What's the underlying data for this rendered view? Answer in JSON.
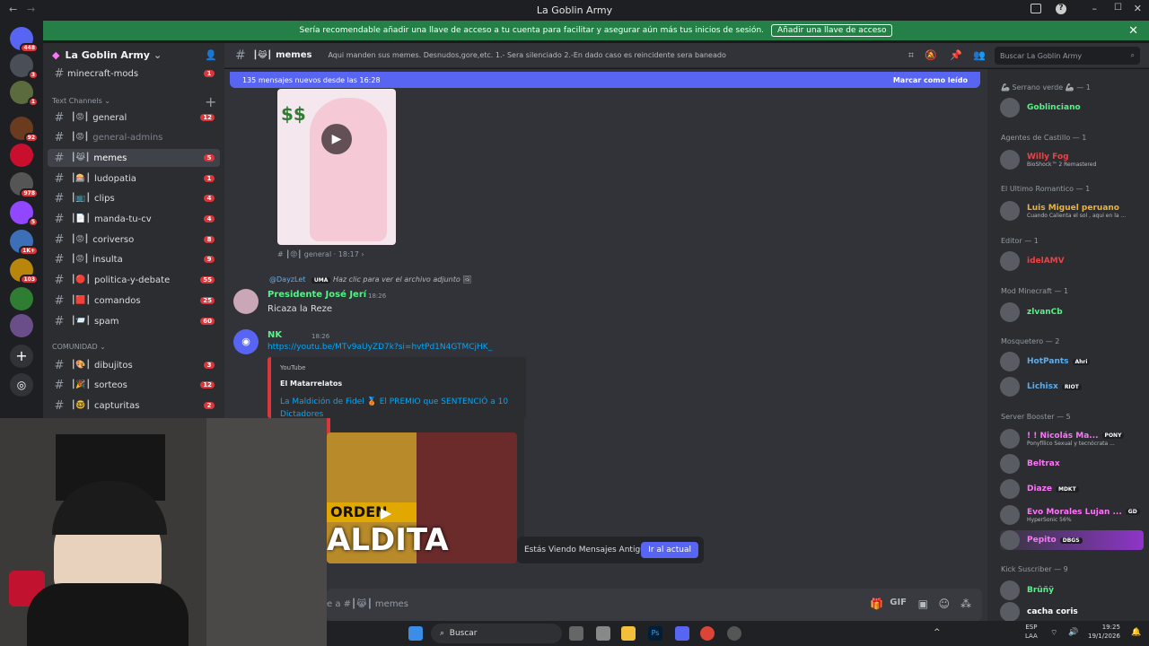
{
  "window": {
    "title": "La Goblin Army"
  },
  "banner": {
    "text": "Sería recomendable añadir una llave de acceso a tu cuenta para facilitar y asegurar aún más tus inicios de sesión.",
    "button": "Añadir una llave de acceso",
    "close": "✕"
  },
  "guilds": {
    "badges": [
      "448",
      "3",
      "1",
      "92",
      "978",
      "5",
      "1K+",
      "103"
    ]
  },
  "server": {
    "name": "La Goblin Army"
  },
  "channels": {
    "top": {
      "name": "minecraft-mods",
      "count": "1"
    },
    "text_category": "Text Channels",
    "items": [
      {
        "name": "general",
        "count": "12",
        "pre": "┃😡┃"
      },
      {
        "name": "general-admins",
        "count": "",
        "pre": "┃😡┃"
      },
      {
        "name": "memes",
        "count": "5",
        "pre": "┃😹┃"
      },
      {
        "name": "ludopatia",
        "count": "1",
        "pre": "┃🎰┃"
      },
      {
        "name": "clips",
        "count": "4",
        "pre": "┃📺┃"
      },
      {
        "name": "manda-tu-cv",
        "count": "4",
        "pre": "┃📄┃"
      },
      {
        "name": "coriverso",
        "count": "8",
        "pre": "┃😡┃"
      },
      {
        "name": "insulta",
        "count": "9",
        "pre": "┃😡┃"
      },
      {
        "name": "politica-y-debate",
        "count": "55",
        "pre": "┃🔴┃"
      },
      {
        "name": "comandos",
        "count": "25",
        "pre": "┃🟥┃"
      },
      {
        "name": "spam",
        "count": "60",
        "pre": "┃📨┃"
      }
    ],
    "community_category": "COMUNIDAD",
    "community": [
      {
        "name": "dibujitos",
        "count": "3",
        "pre": "┃🎨┃"
      },
      {
        "name": "sorteos",
        "count": "12",
        "pre": "┃🎉┃"
      },
      {
        "name": "capturitas",
        "count": "2",
        "pre": "┃🤓┃"
      }
    ]
  },
  "header": {
    "channel": "memes",
    "pre": "┃😹┃",
    "topic": "Aqui manden sus memes. Desnudos,gore,etc. 1.- Sera silenciado 2.-En dado caso es reincidente sera baneado",
    "search_placeholder": "Buscar La Goblin Army"
  },
  "newbar": {
    "text": "135 mensajes nuevos desde las 16:28",
    "mark": "Marcar como leído"
  },
  "messages": {
    "thread_ref": "general · 18:17",
    "reply_user": "@DayzLet",
    "reply_tag": "UMA",
    "reply_text": "Haz clic para ver el archivo adjunto",
    "m1": {
      "author": "Presidente José Jerí",
      "time": "18:26",
      "text": "Ricaza la Reze"
    },
    "m2": {
      "author": "NK",
      "time": "18:26",
      "link": "https://youtu.be/MTv9aUyZD7k?si=hvtPd1N4GTMCjHK_",
      "embed_provider": "YouTube",
      "embed_author": "El Matarrelatos",
      "embed_title": "La Maldición de Fidel 🥉 El PREMIO que SENTENCIÓ a 10 Dictadores"
    }
  },
  "thumb": {
    "line1": "ORDEN",
    "line2": "ALDITA"
  },
  "old_msgs": {
    "text": "Estás Viendo Mensajes Antiguos",
    "button": "Ir al actual"
  },
  "composer": {
    "placeholder": "e a #┃😹┃ memes"
  },
  "members": [
    {
      "cat": "🦾 Serrano verde 🦾 — 1",
      "name": "Goblinciano",
      "color": "#57f287"
    },
    {
      "cat": "Agentes de Castillo — 1",
      "name": "Willy Fog",
      "color": "#ed4245",
      "sub": "BioShock™ 2 Remastered"
    },
    {
      "cat": "El Ultimo Romantico — 1",
      "name": "Luis Miguel peruano",
      "color": "#f0b232",
      "sub": "Cuando Calienta el sol , aqui en la ..."
    },
    {
      "cat": "Editor — 1",
      "name": "idelAMV",
      "color": "#ed4245"
    },
    {
      "cat": "Mod Minecraft — 1",
      "name": "zlvanCb",
      "color": "#57f287"
    },
    {
      "cat": "Mosquetero — 2",
      "name": "HotPants",
      "color": "#5dadec",
      "tag": "Ahri"
    },
    {
      "name": "Lichisx",
      "color": "#5dadec",
      "tag": "RIOT"
    },
    {
      "cat": "Server Booster — 5",
      "name": "! ! Nicolás Ma...",
      "color": "#ff73fa",
      "tag": "PONY",
      "sub": "Ponyfílico Sexual y tecnócrata ..."
    },
    {
      "name": "Beltrax",
      "color": "#ff73fa"
    },
    {
      "name": "Diaze",
      "color": "#ff73fa",
      "tag": "MDKT"
    },
    {
      "name": "Evo Morales Lujan ...",
      "color": "#ff73fa",
      "tag": "GD",
      "sub": "HyperSonic 56%"
    },
    {
      "name": "Pepito",
      "color": "#ff73fa",
      "tag": "DBGS"
    },
    {
      "cat": "Kick Suscriber — 9",
      "name": "Brûñÿ",
      "color": "#57f287"
    },
    {
      "name": "cacha coris",
      "color": "#fff"
    }
  ],
  "taskbar": {
    "search": "Buscar",
    "lang": "ESP",
    "lang2": "LAA",
    "time": "19:25",
    "date": "19/1/2026"
  }
}
